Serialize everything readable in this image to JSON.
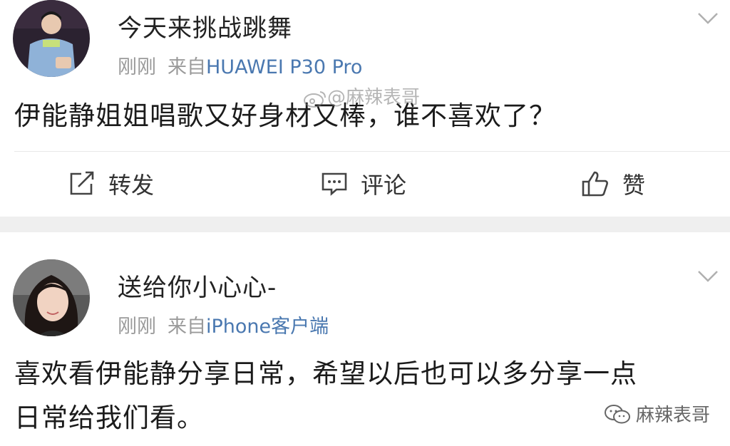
{
  "posts": [
    {
      "username": "今天来挑战跳舞",
      "time": "刚刚",
      "from": "来自",
      "device": "HUAWEI P30 Pro",
      "content": "伊能静姐姐唱歌又好身材又棒，谁不喜欢了？",
      "actions": {
        "repost": "转发",
        "comment": "评论",
        "like": "赞"
      }
    },
    {
      "username": "送给你小心心-",
      "time": "刚刚",
      "from": "来自",
      "device": "iPhone客户端",
      "content_line1": "喜欢看伊能静分享日常，希望以后也可以多分享一点",
      "content_line2": "日常给我们看。"
    }
  ],
  "watermarks": {
    "weibo": "@麻辣表哥",
    "wechat": "麻辣表哥"
  },
  "colors": {
    "device_link": "#4a78b0",
    "meta_gray": "#9a9a9a",
    "separator": "#efefef"
  }
}
